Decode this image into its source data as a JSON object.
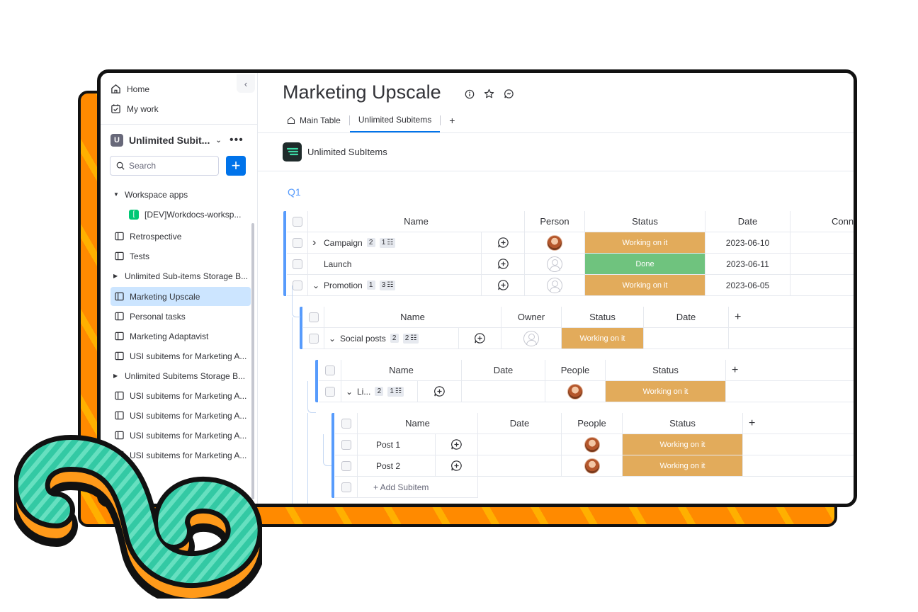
{
  "sidebar": {
    "home": "Home",
    "my_work": "My work",
    "workspace_badge": "U",
    "workspace_name": "Unlimited Subit...",
    "workspace_more": "•••",
    "search_placeholder": "Search",
    "add_label": "+",
    "collapse_label": "‹",
    "items": [
      {
        "label": "Workspace apps",
        "kind": "section"
      },
      {
        "label": "[DEV]Workdocs-worksp...",
        "kind": "app",
        "badge": "["
      },
      {
        "label": "Retrospective",
        "kind": "board"
      },
      {
        "label": "Tests",
        "kind": "board"
      },
      {
        "label": "Unlimited Sub-items Storage B...",
        "kind": "folder"
      },
      {
        "label": "Marketing Upscale",
        "kind": "board",
        "selected": true
      },
      {
        "label": "Personal tasks",
        "kind": "board"
      },
      {
        "label": "Marketing Adaptavist",
        "kind": "board"
      },
      {
        "label": "USI subitems for Marketing A...",
        "kind": "board"
      },
      {
        "label": "Unlimited Subitems Storage B...",
        "kind": "folder"
      },
      {
        "label": "USI subitems for Marketing A...",
        "kind": "board"
      },
      {
        "label": "USI subitems for Marketing A...",
        "kind": "board"
      },
      {
        "label": "USI subitems for Marketing A...",
        "kind": "board"
      },
      {
        "label": "USI subitems for Marketing A...",
        "kind": "board"
      }
    ]
  },
  "header": {
    "title": "Marketing Upscale",
    "tabs": [
      {
        "label": "Main Table",
        "active": false
      },
      {
        "label": "Unlimited Subitems",
        "active": true
      }
    ],
    "add_tab": "+"
  },
  "board": {
    "app_name": "Unlimited SubItems",
    "group": "Q1"
  },
  "colors": {
    "accent": "#0073ea",
    "group": "#579bfc",
    "working": "#e2ab5b",
    "done": "#6fc37e"
  },
  "main_table": {
    "columns": [
      "Name",
      "Person",
      "Status",
      "Date",
      "Conn"
    ],
    "rows": [
      {
        "name": "Campaign",
        "count": "2",
        "sub": "1",
        "person": "avatar",
        "status": "Working on it",
        "date": "2023-06-10"
      },
      {
        "name": "Launch",
        "count": "",
        "sub": "",
        "person": "empty",
        "status": "Done",
        "date": "2023-06-11"
      },
      {
        "name": "Promotion",
        "count": "1",
        "sub": "3",
        "person": "empty",
        "status": "Working on it",
        "date": "2023-06-05"
      }
    ]
  },
  "sub1": {
    "columns": [
      "Name",
      "Owner",
      "Status",
      "Date",
      "+"
    ],
    "rows": [
      {
        "name": "Social posts",
        "count": "2",
        "sub": "2",
        "owner": "empty",
        "status": "Working on it",
        "date": ""
      }
    ]
  },
  "sub2": {
    "columns": [
      "Name",
      "Date",
      "People",
      "Status",
      "+"
    ],
    "rows": [
      {
        "name": "Li...",
        "count": "2",
        "sub": "1",
        "date": "",
        "people": "avatar",
        "status": "Working on it"
      }
    ]
  },
  "sub3": {
    "columns": [
      "Name",
      "Date",
      "People",
      "Status",
      "+"
    ],
    "rows": [
      {
        "name": "Post 1",
        "date": "",
        "people": "avatar",
        "status": "Working on it"
      },
      {
        "name": "Post 2",
        "date": "",
        "people": "avatar",
        "status": "Working on it"
      }
    ],
    "add_label": "+ Add Subitem"
  }
}
